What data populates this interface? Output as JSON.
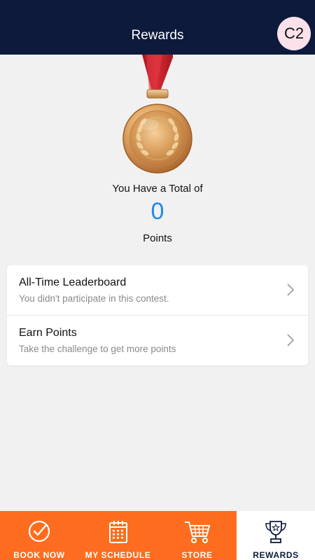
{
  "header": {
    "title": "Rewards",
    "avatar_initials": "C2"
  },
  "summary": {
    "intro": "You Have a Total of",
    "points": "0",
    "unit": "Points"
  },
  "menu": [
    {
      "title": "All-Time Leaderboard",
      "subtitle": "You didn't participate in this contest."
    },
    {
      "title": "Earn Points",
      "subtitle": "Take the challenge to get more points"
    }
  ],
  "tabs": [
    {
      "label": "BOOK NOW",
      "icon": "check-circle-icon"
    },
    {
      "label": "MY SCHEDULE",
      "icon": "calendar-icon"
    },
    {
      "label": "STORE",
      "icon": "cart-icon"
    },
    {
      "label": "REWARDS",
      "icon": "trophy-icon",
      "active": true
    }
  ],
  "colors": {
    "header_bg": "#0d1a3c",
    "accent_blue": "#1e8ae6",
    "tab_orange": "#fe6d1f",
    "ribbon_red": "#c8202c",
    "medal_gold": "#d89a52"
  }
}
